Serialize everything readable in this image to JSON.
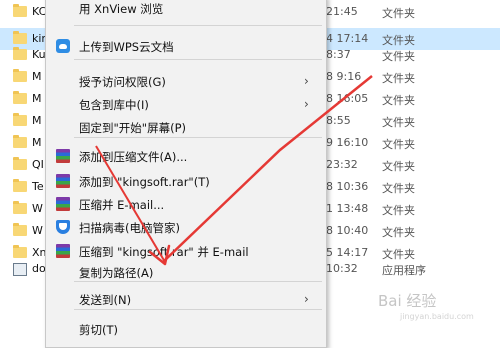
{
  "explorer": {
    "rows": [
      {
        "name": "KC",
        "time": "21:45",
        "type": "文件夹",
        "icon": "folder-icon"
      },
      {
        "name": "kin",
        "time": "4 17:14",
        "type": "文件夹",
        "icon": "folder-icon",
        "selected": true
      },
      {
        "name": "Ku",
        "time": "8:37",
        "type": "文件夹",
        "icon": "folder-icon"
      },
      {
        "name": "M",
        "time": "8 9:16",
        "type": "文件夹",
        "icon": "folder-icon"
      },
      {
        "name": "M",
        "time": "8 16:05",
        "type": "文件夹",
        "icon": "folder-icon"
      },
      {
        "name": "M",
        "time": "8:55",
        "type": "文件夹",
        "icon": "folder-icon"
      },
      {
        "name": "M",
        "time": "9 16:10",
        "type": "文件夹",
        "icon": "folder-icon"
      },
      {
        "name": "QI",
        "time": "23:32",
        "type": "文件夹",
        "icon": "folder-icon"
      },
      {
        "name": "Te",
        "time": "8 10:36",
        "type": "文件夹",
        "icon": "folder-icon"
      },
      {
        "name": "W",
        "time": "1 13:48",
        "type": "文件夹",
        "icon": "folder-icon"
      },
      {
        "name": "W",
        "time": "8 10:40",
        "type": "文件夹",
        "icon": "folder-icon"
      },
      {
        "name": "Xn",
        "time": "5 14:17",
        "type": "文件夹",
        "icon": "folder-icon"
      },
      {
        "name": "do",
        "time": "10:32",
        "type": "应用程序",
        "icon": "app-icon"
      }
    ]
  },
  "menu": {
    "items": [
      {
        "label": "用 XnView 浏览",
        "icon": "",
        "submenu": false
      },
      {
        "label": "上传到WPS云文档",
        "icon": "wps-cloud-icon",
        "submenu": false
      },
      {
        "label": "授予访问权限(G)",
        "icon": "",
        "submenu": true
      },
      {
        "label": "包含到库中(I)",
        "icon": "",
        "submenu": true
      },
      {
        "label": "固定到\"开始\"屏幕(P)",
        "icon": "",
        "submenu": false
      },
      {
        "label": "添加到压缩文件(A)...",
        "icon": "winrar-icon",
        "submenu": false
      },
      {
        "label": "添加到 \"kingsoft.rar\"(T)",
        "icon": "winrar-icon",
        "submenu": false
      },
      {
        "label": "压缩并 E-mail...",
        "icon": "winrar-icon",
        "submenu": false
      },
      {
        "label": "扫描病毒(电脑管家)",
        "icon": "shield-icon",
        "submenu": false
      },
      {
        "label": "压缩到 \"kingsoft.rar\" 并 E-mail",
        "icon": "winrar-icon",
        "submenu": false
      },
      {
        "label": "复制为路径(A)",
        "icon": "",
        "submenu": false
      },
      {
        "label": "发送到(N)",
        "icon": "",
        "submenu": true
      },
      {
        "label": "剪切(T)",
        "icon": "",
        "submenu": false
      }
    ],
    "submenu_arrow": "›"
  },
  "annotation": {
    "color": "#e53935"
  },
  "watermark": {
    "text": "Bai 经验",
    "sub": "jingyan.baidu.com"
  }
}
